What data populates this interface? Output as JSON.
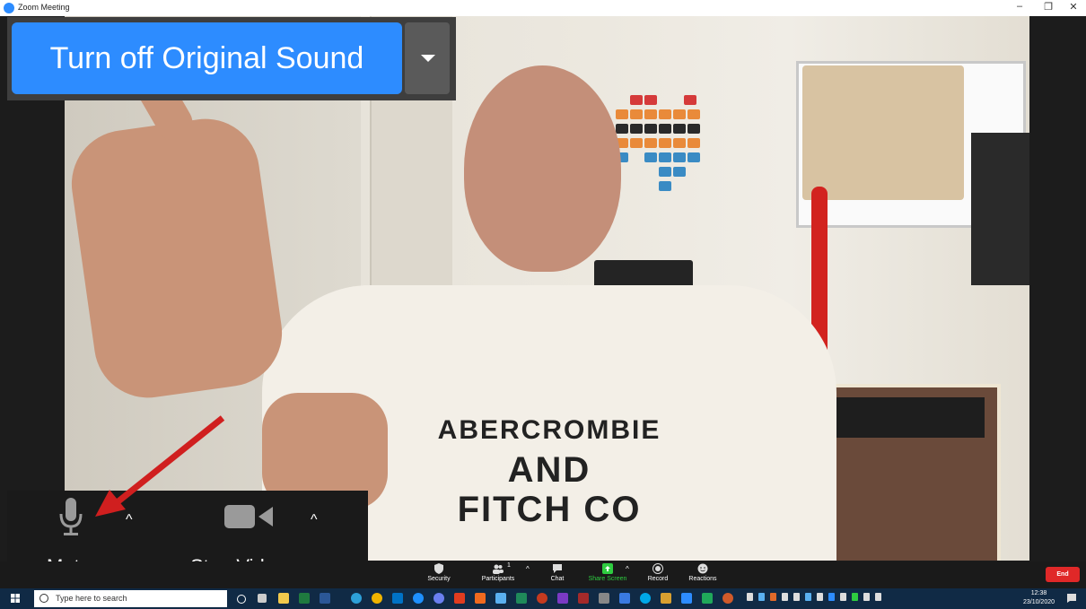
{
  "window": {
    "title": "Zoom Meeting",
    "minimize": "–",
    "restore": "❐",
    "close": "✕"
  },
  "original_sound": {
    "label": "Turn off Original Sound"
  },
  "big_controls": {
    "mute_label": "Mute",
    "video_label": "Stop Video",
    "caret": "^"
  },
  "shirt_text": {
    "line1": "ABERCROMBIE",
    "line2": "AND",
    "line3": "FITCH CO"
  },
  "toolbar": {
    "security": "Security",
    "participants": "Participants",
    "participants_count": "1",
    "chat": "Chat",
    "share_screen": "Share Screen",
    "record": "Record",
    "reactions": "Reactions",
    "end": "End",
    "caret": "^",
    "share_color": "#2ecc40"
  },
  "taskbar": {
    "search_placeholder": "Type here to search",
    "time": "12:38",
    "date": "23/10/2020"
  },
  "colors": {
    "zoom_blue": "#2d8cff",
    "end_red": "#e02828",
    "arrow_red": "#d01f1f"
  }
}
